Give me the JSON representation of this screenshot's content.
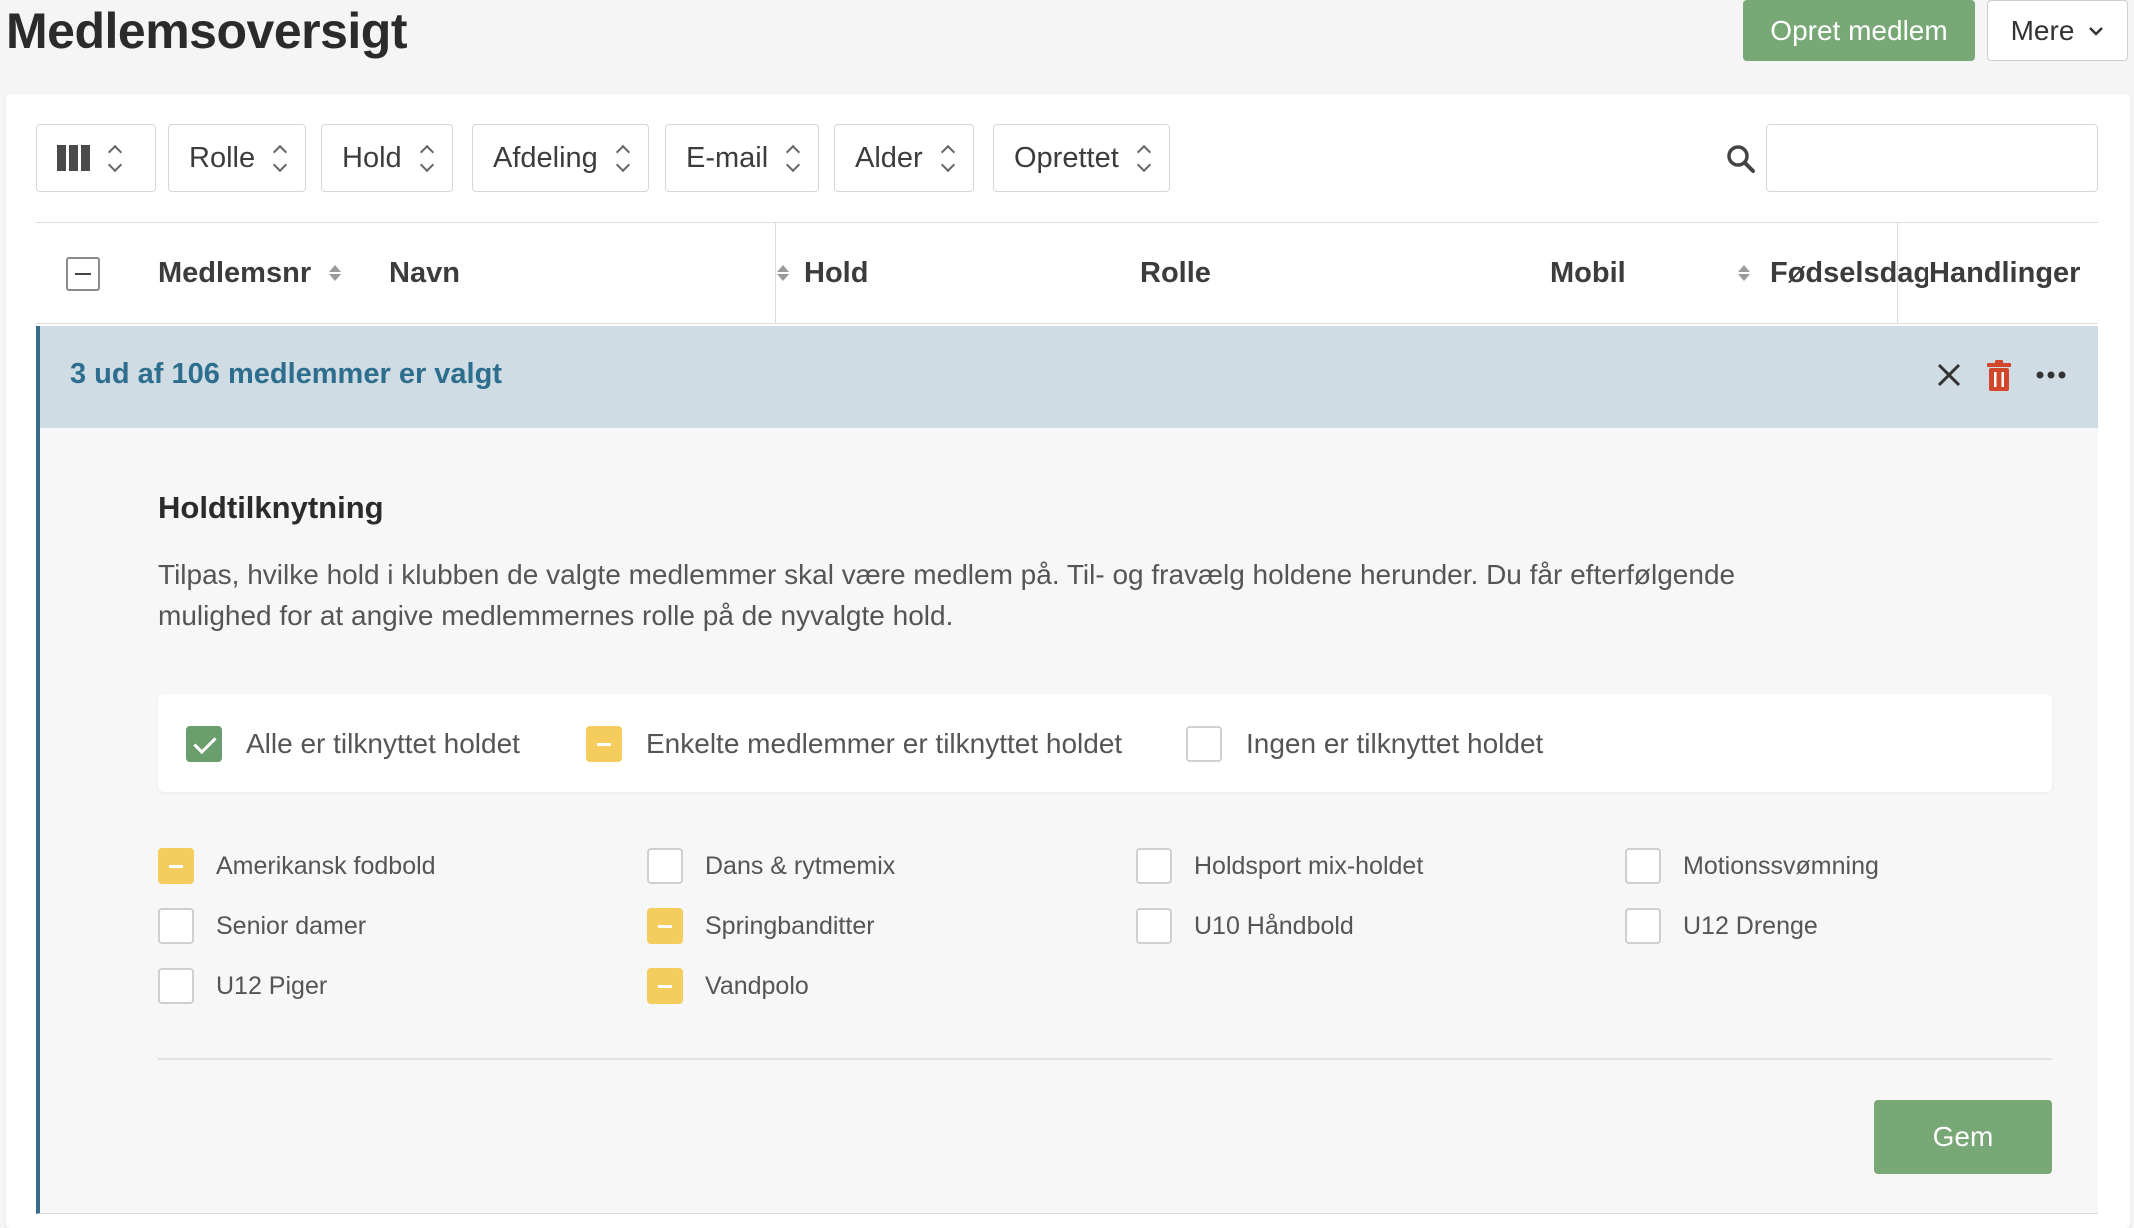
{
  "header": {
    "title": "Medlemsoversigt",
    "create_button": "Opret medlem",
    "more_button": "Mere"
  },
  "filters": {
    "items": [
      "Rolle",
      "Hold",
      "Afdeling",
      "E-mail",
      "Alder",
      "Oprettet"
    ],
    "search_value": ""
  },
  "table": {
    "columns": [
      "Medlemsnr",
      "Navn",
      "Hold",
      "Rolle",
      "Mobil",
      "Fødselsdag",
      "Handlinger"
    ]
  },
  "selection": {
    "text": "3 ud af 106 medlemmer er valgt"
  },
  "panel": {
    "title": "Holdtilknytning",
    "description": "Tilpas, hvilke hold i klubben de valgte medlemmer skal være medlem på. Til- og fravælg holdene herunder. Du får efterfølgende mulighed for at angive medlemmernes rolle på de nyvalgte hold.",
    "legend": [
      {
        "label": "Alle er tilknyttet holdet",
        "state": "checked"
      },
      {
        "label": "Enkelte medlemmer er tilknyttet holdet",
        "state": "partial"
      },
      {
        "label": "Ingen er tilknyttet holdet",
        "state": "empty"
      }
    ],
    "teams": [
      {
        "label": "Amerikansk fodbold",
        "state": "partial"
      },
      {
        "label": "Dans & rytmemix",
        "state": "empty"
      },
      {
        "label": "Holdsport mix-holdet",
        "state": "empty"
      },
      {
        "label": "Motionssvømning",
        "state": "empty"
      },
      {
        "label": "Senior damer",
        "state": "empty"
      },
      {
        "label": "Springbanditter",
        "state": "partial"
      },
      {
        "label": "U10 Håndbold",
        "state": "empty"
      },
      {
        "label": "U12 Drenge",
        "state": "empty"
      },
      {
        "label": "U12 Piger",
        "state": "empty"
      },
      {
        "label": "Vandpolo",
        "state": "partial"
      }
    ],
    "save_button": "Gem"
  },
  "colors": {
    "primary_green": "#77a876",
    "partial_yellow": "#f4cd5e",
    "selection_bg": "#cfdce4",
    "selection_text": "#2d6e8e",
    "delete_red": "#d2462c"
  }
}
